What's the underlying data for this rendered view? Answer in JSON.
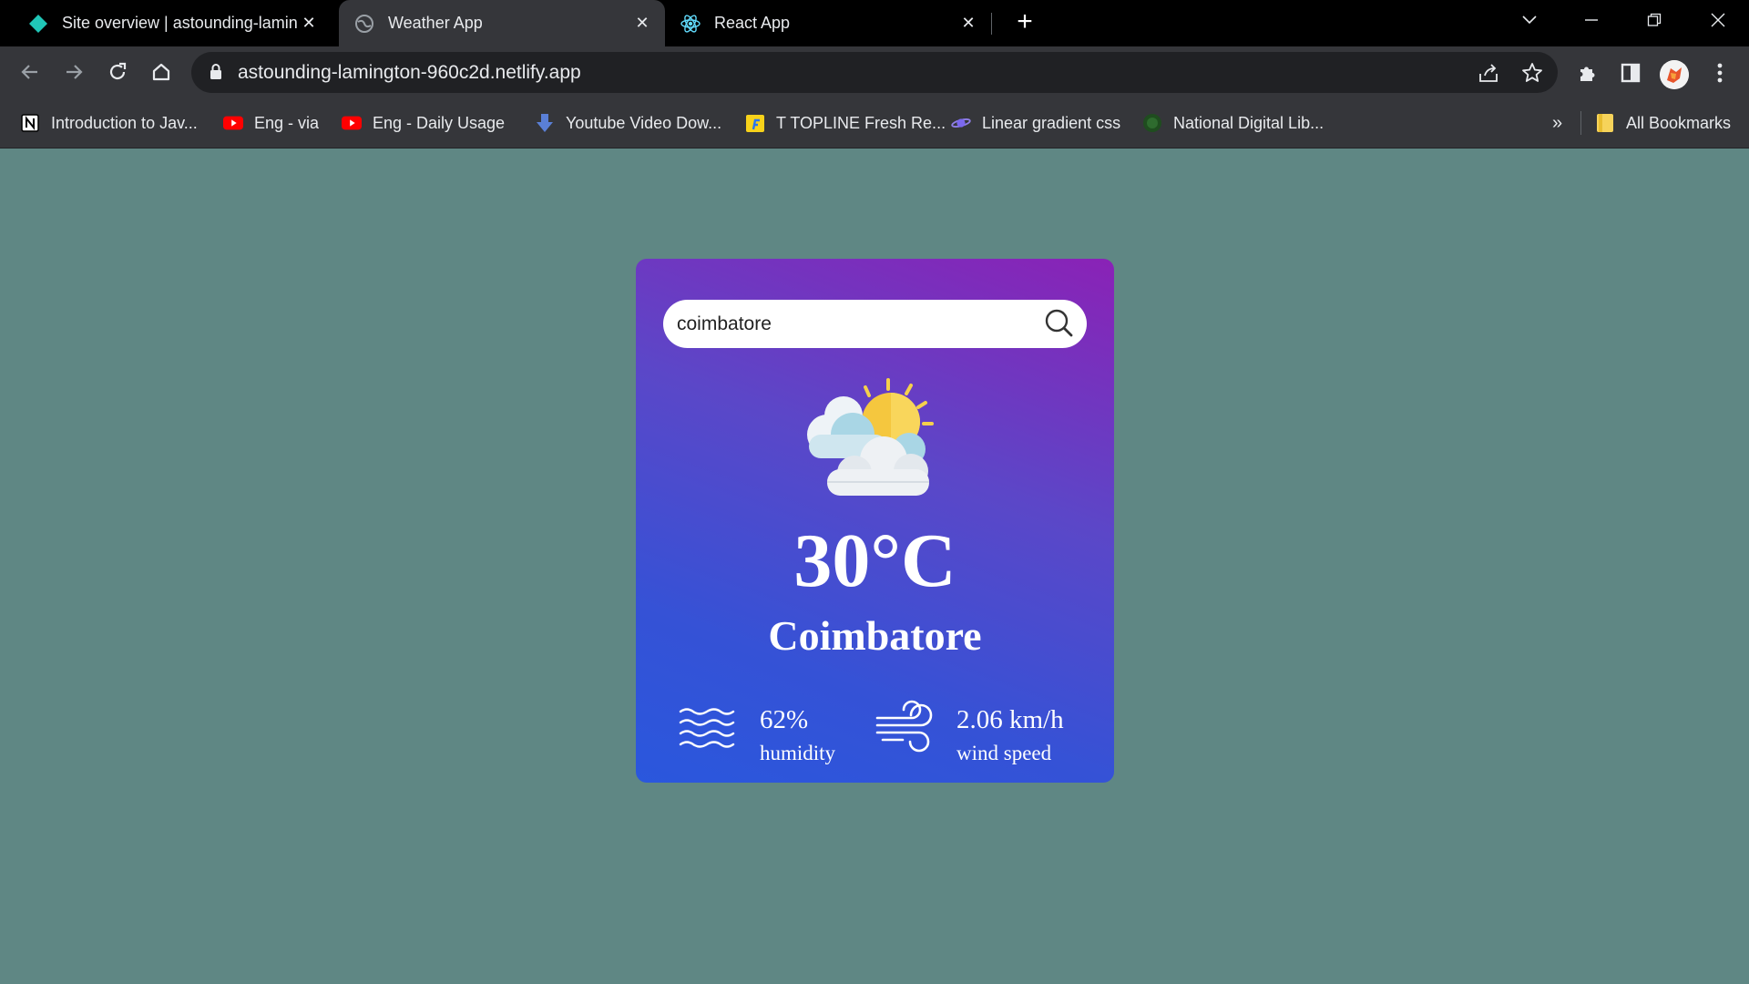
{
  "browser": {
    "tabs": [
      {
        "title": "Site overview | astounding-lamin",
        "active": false
      },
      {
        "title": "Weather App",
        "active": true
      },
      {
        "title": "React App",
        "active": false
      }
    ],
    "address_bar": {
      "url": "astounding-lamington-960c2d.netlify.app"
    },
    "bookmarks": [
      {
        "label": "Introduction to Jav...",
        "icon": "notion-icon"
      },
      {
        "label": "Eng - via",
        "icon": "youtube-icon"
      },
      {
        "label": "Eng -  Daily Usage",
        "icon": "youtube-icon"
      },
      {
        "label": "Youtube Video Dow...",
        "icon": "download-arrow-icon"
      },
      {
        "label": "T TOPLINE Fresh Re...",
        "icon": "flipkart-icon"
      },
      {
        "label": "Linear gradient css",
        "icon": "planet-icon"
      },
      {
        "label": "National Digital Lib...",
        "icon": "globe-icon"
      }
    ],
    "overflow_label": "»",
    "all_bookmarks_label": "All Bookmarks"
  },
  "weather_app": {
    "search": {
      "value": "coimbatore"
    },
    "temperature": "30°C",
    "city": "Coimbatore",
    "humidity": {
      "value": "62%",
      "label": "humidity"
    },
    "wind": {
      "value": "2.06 km/h",
      "label": "wind speed"
    },
    "condition_icon": "sun-behind-clouds-icon"
  },
  "colors": {
    "page_background": "#5f8784",
    "card_gradient_top": "#8a22b6",
    "card_gradient_bottom": "#2a57dd"
  }
}
